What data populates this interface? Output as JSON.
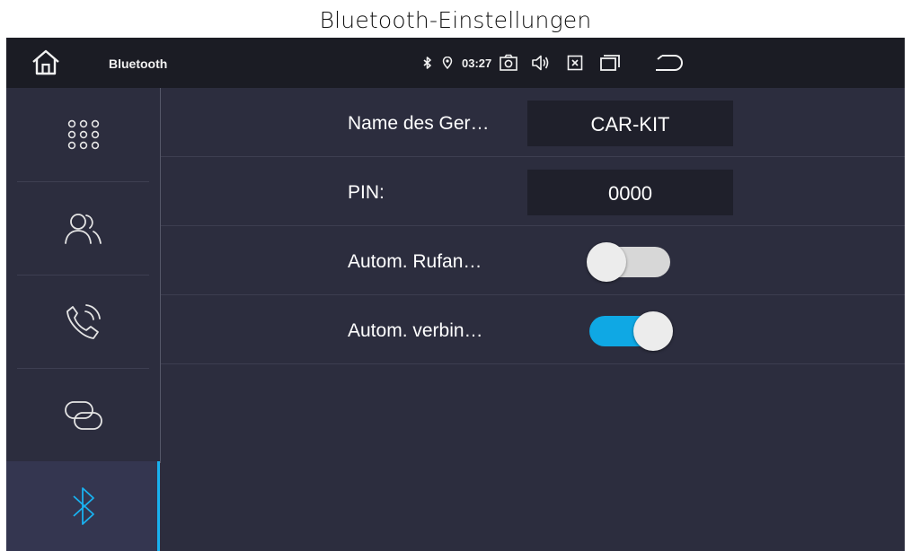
{
  "caption": "Bluetooth-Einstellungen",
  "statusbar": {
    "app_title": "Bluetooth",
    "time": "03:27",
    "icons": [
      "home-icon",
      "bluetooth-icon",
      "location-pin-icon",
      "camera-icon",
      "volume-icon",
      "close-box-icon",
      "recent-apps-icon",
      "back-icon"
    ]
  },
  "sidebar": {
    "items": [
      {
        "name": "apps-grid-icon",
        "active": false
      },
      {
        "name": "contacts-icon",
        "active": false
      },
      {
        "name": "call-log-icon",
        "active": false
      },
      {
        "name": "pairing-link-icon",
        "active": false
      },
      {
        "name": "bluetooth-settings-icon",
        "active": true
      }
    ],
    "accent_color": "#19b1ef"
  },
  "settings": {
    "device_name": {
      "label": "Name des Ger…",
      "value": "CAR-KIT"
    },
    "pin": {
      "label": "PIN:",
      "value": "0000"
    },
    "auto_answer": {
      "label": "Autom. Rufan…",
      "enabled": false
    },
    "auto_connect": {
      "label": "Autom. verbin…",
      "enabled": true
    }
  },
  "colors": {
    "background": "#2c2d3e",
    "statusbar": "#1b1c24",
    "toggle_on": "#0fa8e4",
    "toggle_off": "#d7d7d7"
  }
}
